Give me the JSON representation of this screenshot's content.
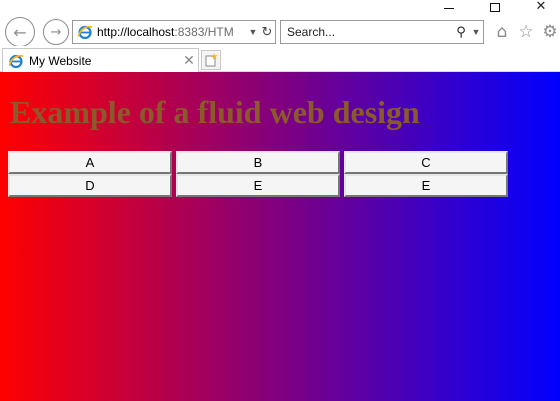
{
  "browser": {
    "address_host": "http://localhost",
    "address_rest": ":8383/HTM",
    "search_placeholder": "Search...",
    "tab_title": "My Website"
  },
  "page": {
    "heading": "Example of a fluid web design",
    "heading_color": "#8b5a2b",
    "background_gradient": [
      "#ff0000",
      "#800080",
      "#0000ff"
    ],
    "buttons": [
      [
        "A",
        "B",
        "C"
      ],
      [
        "D",
        "E",
        "E"
      ]
    ]
  }
}
